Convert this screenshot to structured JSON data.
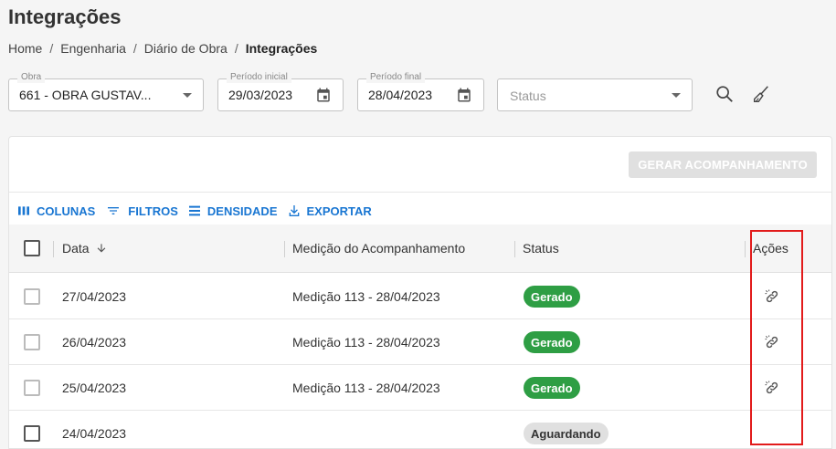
{
  "header": {
    "title": "Integrações"
  },
  "breadcrumb": {
    "items": [
      "Home",
      "Engenharia",
      "Diário de Obra",
      "Integrações"
    ],
    "separator": "/"
  },
  "filters": {
    "obra": {
      "label": "Obra",
      "value": "661 - OBRA GUSTAV..."
    },
    "periodo_inicial": {
      "label": "Período inicial",
      "value": "29/03/2023"
    },
    "periodo_final": {
      "label": "Período final",
      "value": "28/04/2023"
    },
    "status": {
      "placeholder": "Status"
    }
  },
  "actions": {
    "gerar_label": "GERAR ACOMPANHAMENTO"
  },
  "toolbar": {
    "colunas": "COLUNAS",
    "filtros": "FILTROS",
    "densidade": "DENSIDADE",
    "exportar": "EXPORTAR"
  },
  "table": {
    "columns": [
      "Data",
      "Medição do Acompanhamento",
      "Status",
      "Ações"
    ],
    "rows": [
      {
        "data": "27/04/2023",
        "medicao": "Medição 113 - 28/04/2023",
        "status": "Gerado"
      },
      {
        "data": "26/04/2023",
        "medicao": "Medição 113 - 28/04/2023",
        "status": "Gerado"
      },
      {
        "data": "25/04/2023",
        "medicao": "Medição 113 - 28/04/2023",
        "status": "Gerado"
      },
      {
        "data": "24/04/2023",
        "medicao": "",
        "status": "Aguardando"
      }
    ]
  },
  "colors": {
    "accent": "#1976d2",
    "success": "#2e9e44",
    "highlight": "#e21b1b"
  }
}
